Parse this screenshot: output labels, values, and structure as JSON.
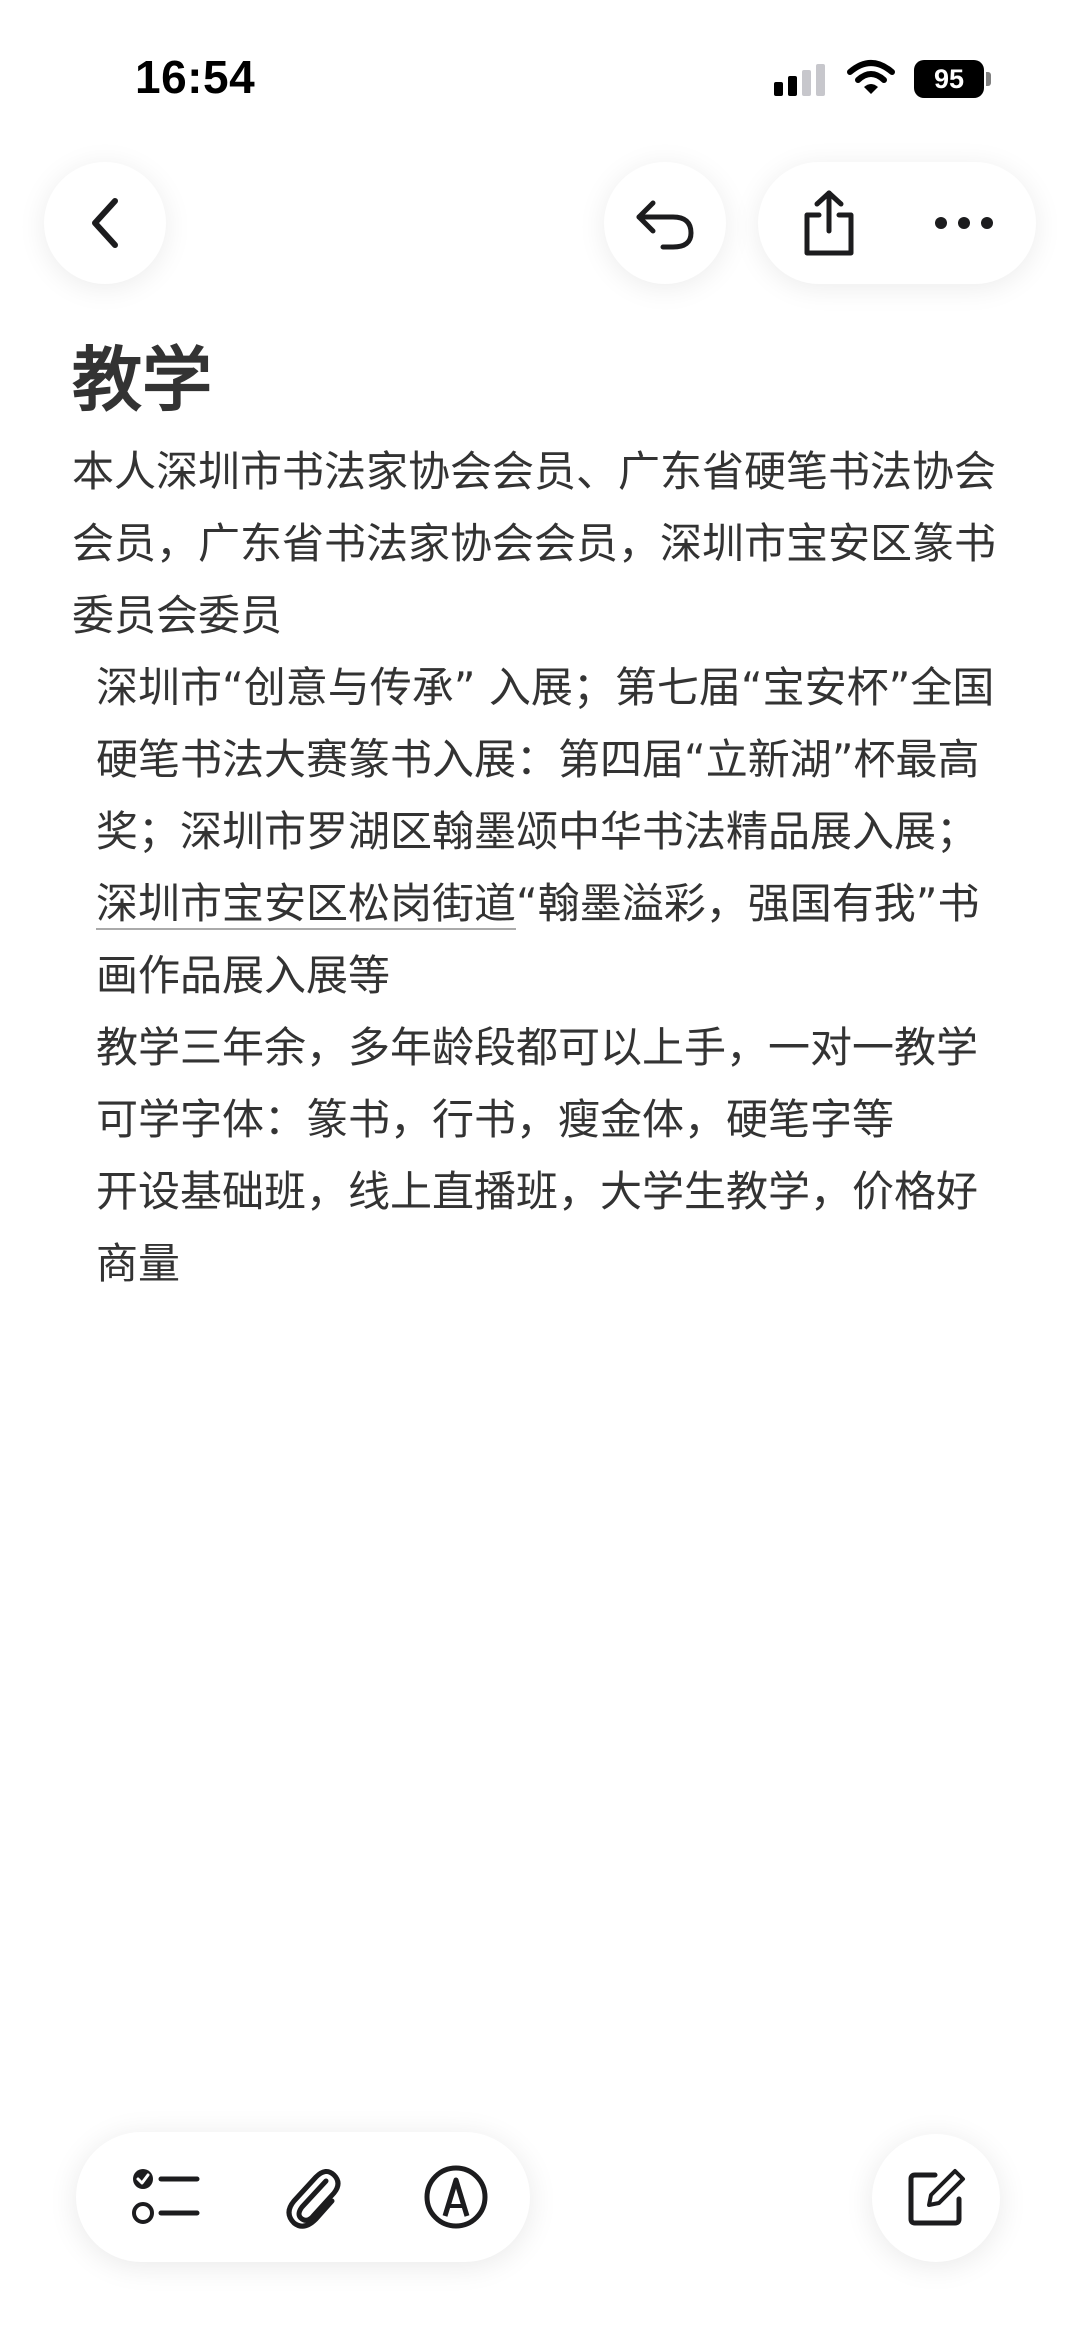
{
  "status": {
    "time": "16:54",
    "battery": "95"
  },
  "toolbar": {
    "back_icon": "chevron-left-icon",
    "undo_icon": "undo-icon",
    "share_icon": "share-icon",
    "more_icon": "ellipsis-icon"
  },
  "note": {
    "title": "教学",
    "paragraphs": [
      "本人深圳市书法家协会会员、广东省硬笔书法协会会员，广东省书法家协会会员，深圳市宝安区篆书委员会委员",
      "深圳市“创意与传承” 入展；第七届“宝安杯”全国硬笔书法大赛篆书入展：第四届“立新湖”杯最高奖；深圳市罗湖区翰墨颂中华书法精品展入展；",
      "深圳市宝安区松岗街道",
      "“翰墨溢彩，强国有我”书画作品展入展等",
      "教学三年余，多年龄段都可以上手，一对一教学",
      "可学字体：篆书，行书，瘦金体，硬笔字等",
      "开设基础班，线上直播班，大学生教学，价格好商量"
    ]
  },
  "bottom_toolbar": {
    "checklist_icon": "checklist-icon",
    "attach_icon": "paperclip-icon",
    "markup_icon": "pen-markup-icon",
    "compose_icon": "compose-icon"
  },
  "colors": {
    "text": "#333333",
    "background": "#ffffff",
    "icon": "#1c1c1e"
  }
}
